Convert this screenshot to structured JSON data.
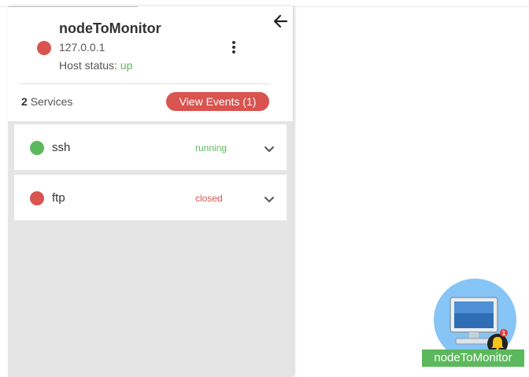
{
  "panel": {
    "node_name": "nodeToMonitor",
    "node_ip": "127.0.0.1",
    "host_status_label": "Host status:",
    "host_status_value": "up",
    "host_status_color": "#d9534f",
    "services_count": "2",
    "services_label": "Services",
    "view_events_label": "View Events (1)"
  },
  "services": [
    {
      "name": "ssh",
      "state": "running",
      "dot_color": "#5cb85c",
      "state_color": "#5cb85c"
    },
    {
      "name": "ftp",
      "state": "closed",
      "dot_color": "#d9534f",
      "state_color": "#d9534f"
    }
  ],
  "graph": {
    "node_label": "nodeToMonitor",
    "notification_count": "1"
  },
  "colors": {
    "accent_red": "#d9534f",
    "accent_green": "#5cb85c",
    "node_circle": "#86c5f5"
  },
  "icons": {
    "back": "arrow-left-icon",
    "menu": "kebab-menu-icon",
    "expand": "chevron-down-icon",
    "computer": "monitor-icon",
    "notification": "bell-icon"
  }
}
